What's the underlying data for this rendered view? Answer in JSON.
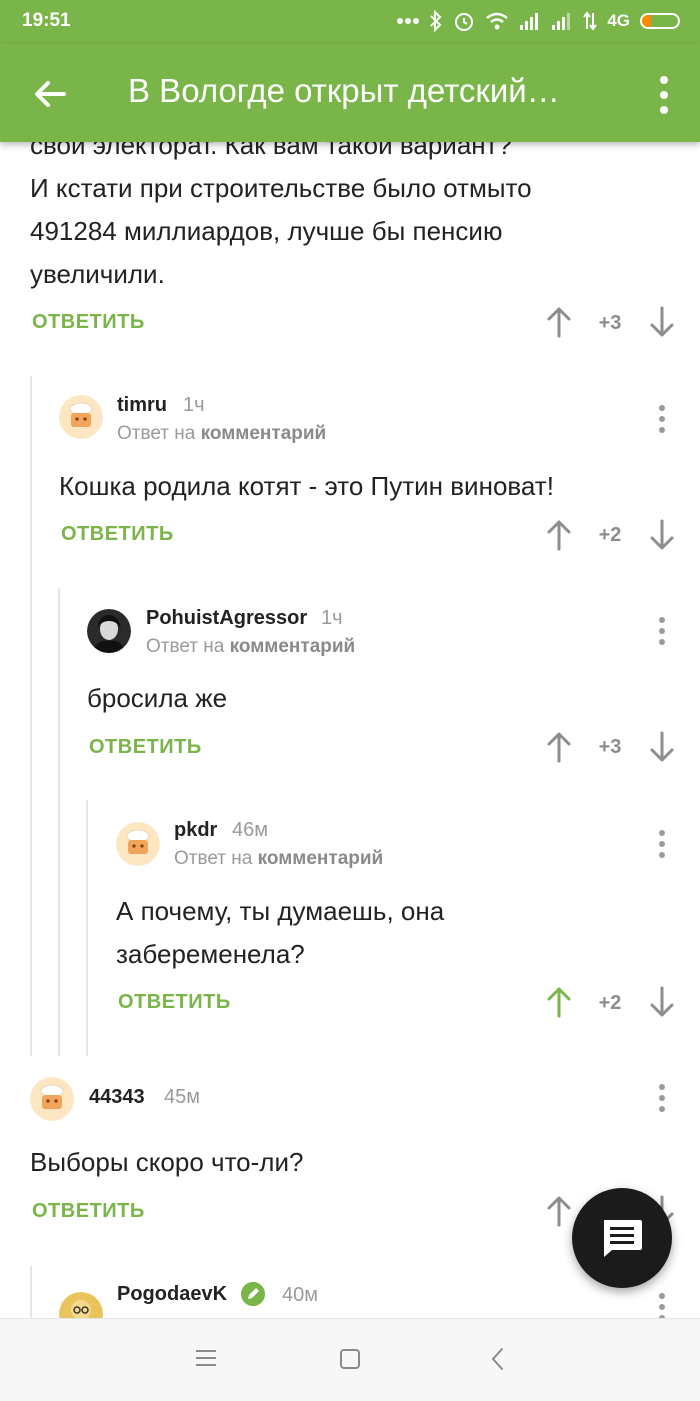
{
  "status_bar": {
    "time": "19:51",
    "network": "4G",
    "battery_level": 0.25
  },
  "app_bar": {
    "title": "В Вологде открыт детский…"
  },
  "reply_to_prefix": "Ответ на ",
  "reply_to_target": "комментарий",
  "comments": [
    {
      "body_lines": [
        "свой электорат. Как вам такой вариант?",
        "И кстати при строительстве было отмыто",
        "491284 миллиардов, лучше бы пенсию",
        "увеличили."
      ],
      "reply_label": "ОТВЕТИТЬ",
      "score": "+3"
    },
    {
      "user": "timru",
      "time": "1ч",
      "body": "Кошка родила котят - это Путин виноват!",
      "reply_label": "ОТВЕТИТЬ",
      "score": "+2"
    },
    {
      "user": "PohuistAgressor",
      "time": "1ч",
      "body": "бросила же",
      "reply_label": "ОТВЕТИТЬ",
      "score": "+3"
    },
    {
      "user": "pkdr",
      "time": "46м",
      "body_lines": [
        "А почему, ты думаешь, она",
        "забеременела?"
      ],
      "reply_label": "ОТВЕТИТЬ",
      "score": "+2"
    },
    {
      "user": "44343",
      "time": "45м",
      "body": "Выборы скоро что-ли?",
      "reply_label": "ОТВЕТИТЬ"
    },
    {
      "user": "PogodaevK",
      "time": "40м"
    }
  ],
  "colors": {
    "accent": "#79b548",
    "upvote_active": "#79b548",
    "fab": "#1b1b1b"
  }
}
